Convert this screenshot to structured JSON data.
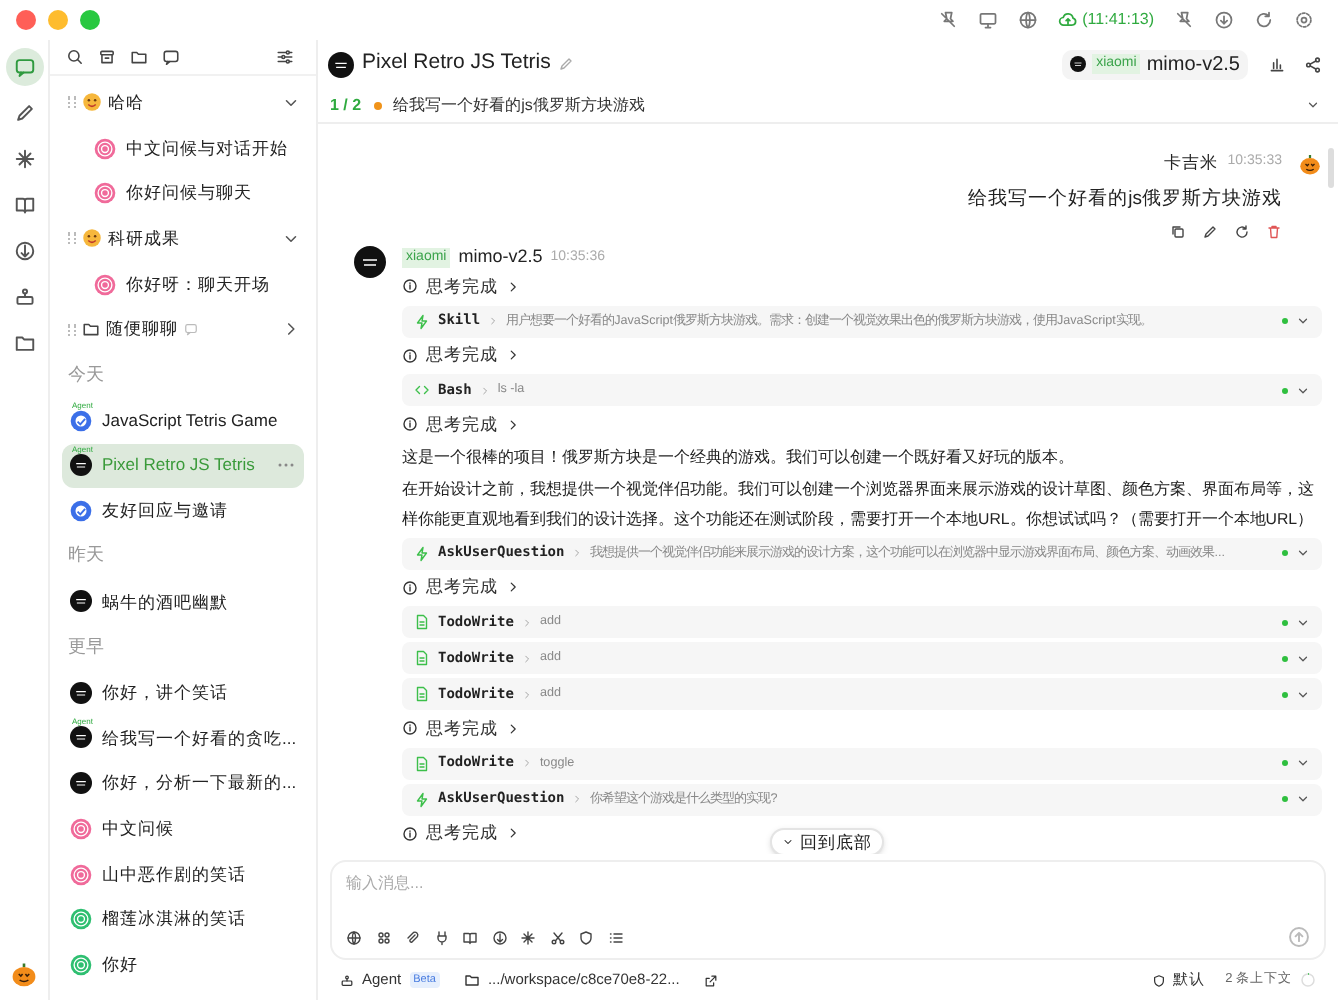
{
  "window": {
    "sync_time": "(11:41:13)"
  },
  "rail": [
    {
      "selected": true
    },
    {
      "selected": false
    },
    {
      "selected": false
    },
    {
      "selected": false
    },
    {
      "selected": false
    },
    {
      "selected": false
    },
    {
      "selected": false
    }
  ],
  "sidebar": {
    "groups": [
      {
        "kind": "emoji",
        "name": "哈哈",
        "expanded": true,
        "children": [
          {
            "title": "中文问候与对话开始",
            "color": "#f06a9a"
          },
          {
            "title": "你好问候与聊天",
            "color": "#f06a9a"
          }
        ]
      },
      {
        "kind": "emoji",
        "name": "科研成果",
        "expanded": true,
        "children": [
          {
            "title": "你好呀：聊天开场",
            "color": "#f06a9a"
          }
        ]
      },
      {
        "kind": "folder",
        "name": "随便聊聊",
        "expanded": false
      }
    ],
    "sections": [
      {
        "label": "今天",
        "chats": [
          {
            "title": "JavaScript Tetris Game",
            "color": "#3b6fe8",
            "badge": "Agent",
            "selected": false
          },
          {
            "title": "Pixel Retro JS Tetris",
            "color": "#111111",
            "badge": "Agent",
            "selected": true
          },
          {
            "title": "友好回应与邀请",
            "color": "#3b6fe8",
            "selected": false
          }
        ]
      },
      {
        "label": "昨天",
        "chats": [
          {
            "title": "蜗牛的酒吧幽默",
            "color": "#111111",
            "selected": false
          }
        ]
      },
      {
        "label": "更早",
        "chats": [
          {
            "title": "你好，讲个笑话",
            "color": "#111111",
            "selected": false
          },
          {
            "title": "给我写一个好看的贪吃...",
            "color": "#111111",
            "badge": "Agent",
            "selected": false
          },
          {
            "title": "你好，分析一下最新的...",
            "color": "#111111",
            "selected": false
          },
          {
            "title": "中文问候",
            "color": "#f06a9a",
            "selected": false
          },
          {
            "title": "山中恶作剧的笑话",
            "color": "#f06a9a",
            "selected": false
          },
          {
            "title": "榴莲冰淇淋的笑话",
            "color": "#2fbf71",
            "selected": false
          },
          {
            "title": "你好",
            "color": "#2fbf71",
            "selected": false
          }
        ]
      }
    ]
  },
  "chat": {
    "title": "Pixel Retro JS Tetris",
    "model_tag": "xiaomi",
    "model": "mimo-v2.5",
    "progress": "1 / 2",
    "prompt": "给我写一个好看的js俄罗斯方块游戏"
  },
  "user_message": {
    "name": "卡吉米",
    "time": "10:35:33",
    "text": "给我写一个好看的js俄罗斯方块游戏"
  },
  "assistant_message": {
    "tag": "xiaomi",
    "model": "mimo-v2.5",
    "time": "10:35:36",
    "blocks": [
      {
        "kind": "thinking",
        "label": "思考完成"
      },
      {
        "kind": "skill",
        "name": "Skill",
        "detail": "用户想要一个好看的JavaScript俄罗斯方块游戏。需求：创建一个视觉效果出色的俄罗斯方块游戏，使用JavaScript实现。",
        "done": true
      },
      {
        "kind": "thinking",
        "label": "思考完成"
      },
      {
        "kind": "bash",
        "name": "Bash",
        "detail": "ls -la",
        "done": true
      },
      {
        "kind": "thinking",
        "label": "思考完成"
      },
      {
        "kind": "text",
        "text": "这是一个很棒的项目！俄罗斯方块是一个经典的游戏。我们可以创建一个既好看又好玩的版本。"
      },
      {
        "kind": "text",
        "text": "在开始设计之前，我想提供一个视觉伴侣功能。我们可以创建一个浏览器界面来展示游戏的设计草图、颜色方案、界面布局等，这样你能更直观地看到我们的设计选择。这个功能还在测试阶段，需要打开一个本地URL。你想试试吗？（需要打开一个本地URL）"
      },
      {
        "kind": "skill",
        "name": "AskUserQuestion",
        "detail": "我想提供一个视觉伴侣功能来展示游戏的设计方案，这个功能可以在浏览器中显示游戏界面布局、颜色方案、动画效果...",
        "done": true
      },
      {
        "kind": "thinking",
        "label": "思考完成"
      },
      {
        "kind": "todo",
        "name": "TodoWrite",
        "detail": "add",
        "done": true
      },
      {
        "kind": "todo",
        "name": "TodoWrite",
        "detail": "add",
        "done": true
      },
      {
        "kind": "todo",
        "name": "TodoWrite",
        "detail": "add",
        "done": true
      },
      {
        "kind": "thinking",
        "label": "思考完成"
      },
      {
        "kind": "todo",
        "name": "TodoWrite",
        "detail": "toggle",
        "done": true
      },
      {
        "kind": "skill",
        "name": "AskUserQuestion",
        "detail": "你希望这个游戏是什么类型的实现?",
        "done": true
      },
      {
        "kind": "thinking",
        "label": "思考完成"
      }
    ]
  },
  "scroll_button": "回到底部",
  "composer": {
    "placeholder": "输入消息..."
  },
  "footer": {
    "mode": "Agent",
    "badge": "Beta",
    "path": ".../workspace/c8ce70e8-22...",
    "permission": "默认",
    "context": "2 条上下文"
  }
}
